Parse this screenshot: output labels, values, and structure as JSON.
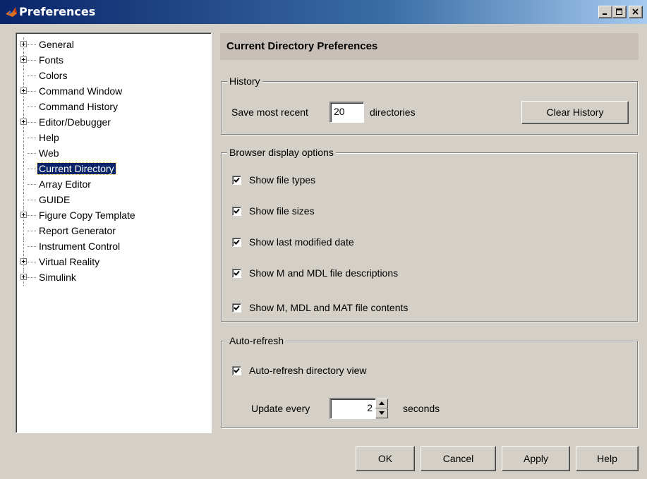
{
  "window": {
    "title": "Preferences",
    "icon": "matlab-logo-icon",
    "controls": {
      "minimize": "_",
      "maximize": "□",
      "close": "×"
    }
  },
  "tree": {
    "items": [
      {
        "label": "General",
        "expandable": true
      },
      {
        "label": "Fonts",
        "expandable": true
      },
      {
        "label": "Colors",
        "expandable": false
      },
      {
        "label": "Command Window",
        "expandable": true
      },
      {
        "label": "Command History",
        "expandable": false
      },
      {
        "label": "Editor/Debugger",
        "expandable": true
      },
      {
        "label": "Help",
        "expandable": false
      },
      {
        "label": "Web",
        "expandable": false
      },
      {
        "label": "Current Directory",
        "expandable": false,
        "selected": true
      },
      {
        "label": "Array Editor",
        "expandable": false
      },
      {
        "label": "GUIDE",
        "expandable": false
      },
      {
        "label": "Figure Copy Template",
        "expandable": true
      },
      {
        "label": "Report Generator",
        "expandable": false
      },
      {
        "label": "Instrument Control",
        "expandable": false
      },
      {
        "label": "Virtual Reality",
        "expandable": true
      },
      {
        "label": "Simulink",
        "expandable": true
      }
    ]
  },
  "main": {
    "header": "Current Directory Preferences",
    "history": {
      "legend": "History",
      "prefix": "Save most recent",
      "count": "20",
      "suffix": "directories",
      "clear_button": "Clear History"
    },
    "browser": {
      "legend": "Browser display options",
      "options": [
        {
          "label": "Show file types",
          "checked": true
        },
        {
          "label": "Show file sizes",
          "checked": true
        },
        {
          "label": "Show last modified date",
          "checked": true
        },
        {
          "label": "Show M and MDL file descriptions",
          "checked": true
        },
        {
          "label": "Show M, MDL and MAT file contents",
          "checked": true
        }
      ]
    },
    "autorefresh": {
      "legend": "Auto-refresh",
      "checkbox_label": "Auto-refresh directory view",
      "checked": true,
      "update_prefix": "Update every",
      "update_value": "2",
      "update_suffix": "seconds"
    }
  },
  "buttons": {
    "ok": "OK",
    "cancel": "Cancel",
    "apply": "Apply",
    "help": "Help"
  }
}
